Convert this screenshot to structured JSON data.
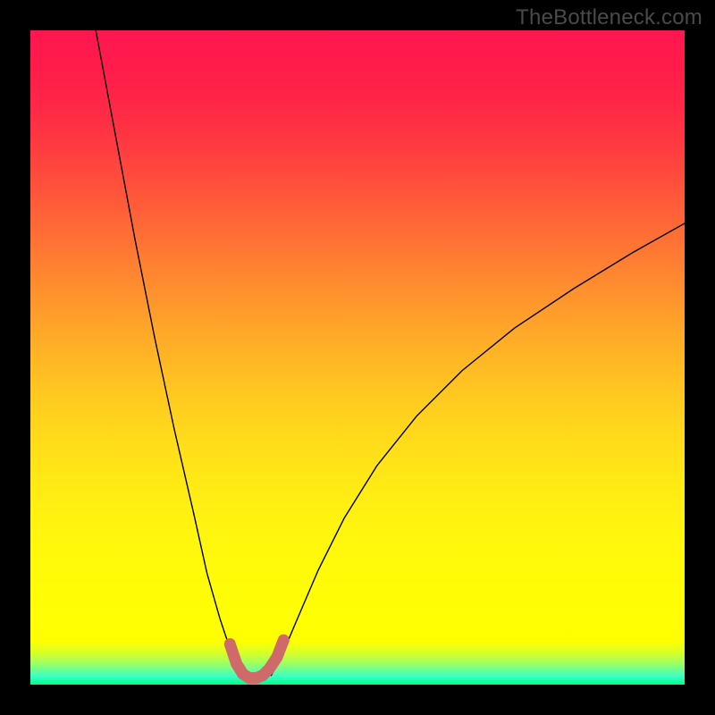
{
  "watermark": "TheBottleneck.com",
  "chart_data": {
    "type": "line",
    "title": "",
    "xlabel": "",
    "ylabel": "",
    "xlim": [
      0,
      100
    ],
    "ylim": [
      0,
      100
    ],
    "series": [
      {
        "name": "curve-left",
        "stroke": "#000000",
        "stroke_width": 1.4,
        "x": [
          10,
          13,
          16,
          19,
          22,
          25,
          27,
          29,
          30.5,
          31.5,
          32.2
        ],
        "y": [
          100,
          84,
          68,
          53,
          39,
          26,
          17,
          10,
          5.5,
          3,
          1.4
        ]
      },
      {
        "name": "curve-right",
        "stroke": "#000000",
        "stroke_width": 1.4,
        "x": [
          36.8,
          37.7,
          39,
          41,
          44,
          48,
          53,
          59,
          66,
          74,
          83,
          92,
          100
        ],
        "y": [
          1.4,
          3,
          5.8,
          10.5,
          17.5,
          25.5,
          33.5,
          41,
          48,
          54.5,
          60.5,
          66,
          70.5
        ]
      },
      {
        "name": "trough-highlight",
        "stroke": "#d06a6a",
        "stroke_width": 13,
        "x": [
          30.5,
          31.5,
          32.5,
          33.5,
          34.5,
          35.5,
          36.5,
          37.7,
          38.7
        ],
        "y": [
          6.2,
          3.2,
          1.6,
          1.0,
          1.0,
          1.4,
          2.4,
          4.2,
          6.8
        ]
      }
    ],
    "background_gradient": {
      "stops": [
        {
          "offset": 0.0,
          "color": "#ff1750"
        },
        {
          "offset": 0.058,
          "color": "#ff1c4b"
        },
        {
          "offset": 0.117,
          "color": "#ff2846"
        },
        {
          "offset": 0.175,
          "color": "#ff3a41"
        },
        {
          "offset": 0.233,
          "color": "#ff4f3c"
        },
        {
          "offset": 0.292,
          "color": "#ff6637"
        },
        {
          "offset": 0.35,
          "color": "#ff7d32"
        },
        {
          "offset": 0.408,
          "color": "#ff942d"
        },
        {
          "offset": 0.467,
          "color": "#ffaa28"
        },
        {
          "offset": 0.525,
          "color": "#ffbe23"
        },
        {
          "offset": 0.583,
          "color": "#ffd01e"
        },
        {
          "offset": 0.642,
          "color": "#ffdf19"
        },
        {
          "offset": 0.7,
          "color": "#ffeb14"
        },
        {
          "offset": 0.758,
          "color": "#fff40f"
        },
        {
          "offset": 0.817,
          "color": "#fffa0a"
        },
        {
          "offset": 0.875,
          "color": "#fffd05"
        },
        {
          "offset": 0.933,
          "color": "#ffff00"
        },
        {
          "offset": 0.951,
          "color": "#d8ff28"
        },
        {
          "offset": 0.965,
          "color": "#a8ff58"
        },
        {
          "offset": 0.977,
          "color": "#70ff90"
        },
        {
          "offset": 0.988,
          "color": "#38ffc8"
        },
        {
          "offset": 1.0,
          "color": "#00ff7e"
        }
      ]
    }
  }
}
